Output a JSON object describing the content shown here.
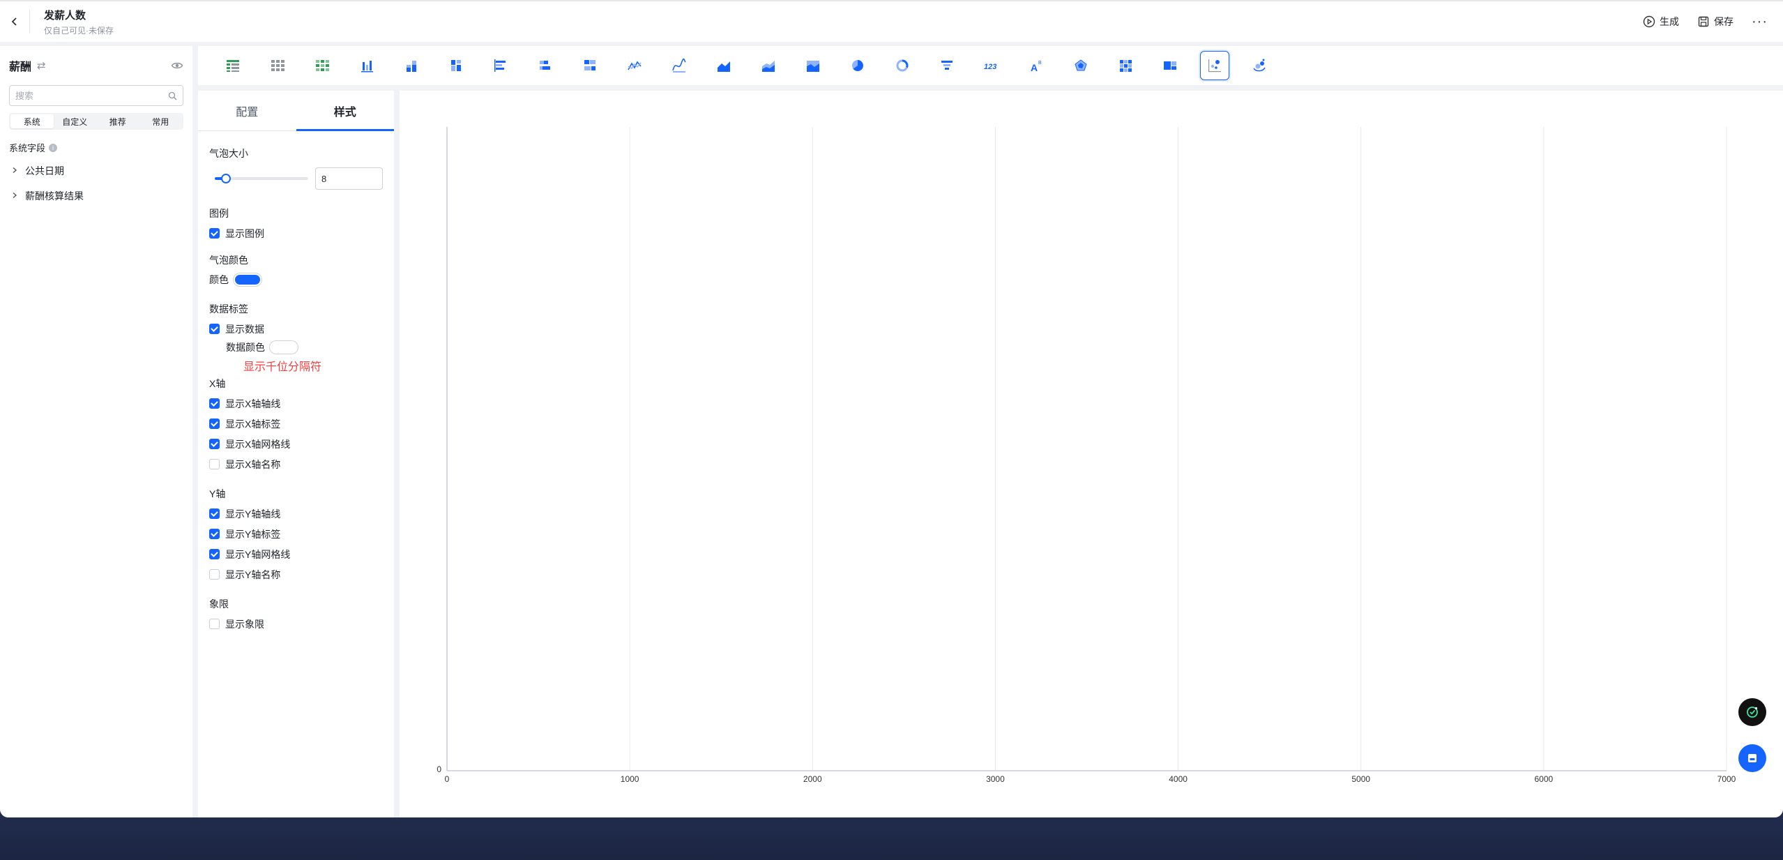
{
  "header": {
    "title": "发薪人数",
    "subtitle": "仅自己可见·未保存",
    "generate_label": "生成",
    "save_label": "保存",
    "more_label": "···"
  },
  "sidebar": {
    "title": "薪酬",
    "search_placeholder": "搜索",
    "segments": [
      "系统",
      "自定义",
      "推荐",
      "常用"
    ],
    "active_segment": 0,
    "section_label": "系统字段",
    "info_glyph": "i",
    "tree_items": [
      "公共日期",
      "薪酬核算结果"
    ]
  },
  "chart_types": [
    "table",
    "cross-table",
    "color-table",
    "bar",
    "stacked-bar",
    "grouped-bar",
    "horizontal-bar",
    "horizontal-stacked-bar",
    "horizontal-grouped-bar",
    "line",
    "smooth-line",
    "area",
    "stacked-area",
    "percent-area",
    "pie",
    "donut",
    "funnel",
    "number-card",
    "indicator-card",
    "radar",
    "heatmap",
    "treemap",
    "scatter",
    "bubble"
  ],
  "active_chart_type": 22,
  "config": {
    "tabs": [
      "配置",
      "样式"
    ],
    "active_tab": 1,
    "bubble_size": {
      "label": "气泡大小",
      "value": "8",
      "fraction": 0.12
    },
    "legend": {
      "title": "图例",
      "options": [
        {
          "label": "显示图例",
          "checked": true
        }
      ]
    },
    "bubble_color": {
      "title": "气泡颜色",
      "color_label": "颜色",
      "color": "#1664ff"
    },
    "data_label": {
      "title": "数据标签",
      "options": [
        {
          "label": "显示数据",
          "checked": true
        }
      ],
      "data_color_label": "数据颜色",
      "data_color": "#ffffff",
      "thousand_sep_label": "显示千位分隔符"
    },
    "x_axis": {
      "title": "X轴",
      "options": [
        {
          "label": "显示X轴轴线",
          "checked": true
        },
        {
          "label": "显示X轴标签",
          "checked": true
        },
        {
          "label": "显示X轴网格线",
          "checked": true
        },
        {
          "label": "显示X轴名称",
          "checked": false
        }
      ]
    },
    "y_axis": {
      "title": "Y轴",
      "options": [
        {
          "label": "显示Y轴轴线",
          "checked": true
        },
        {
          "label": "显示Y轴标签",
          "checked": true
        },
        {
          "label": "显示Y轴网格线",
          "checked": true
        },
        {
          "label": "显示Y轴名称",
          "checked": false
        }
      ]
    },
    "quadrant": {
      "title": "象限",
      "options": [
        {
          "label": "显示象限",
          "checked": false
        }
      ]
    }
  },
  "colors": {
    "accent": "#1664ff",
    "warning": "#f53f3f"
  },
  "chart_data": {
    "type": "scatter",
    "x_ticks": [
      0,
      1000,
      2000,
      3000,
      4000,
      5000,
      6000,
      7000
    ],
    "y_ticks": [
      0
    ],
    "xlim": [
      0,
      7000
    ],
    "grid": true,
    "series": []
  }
}
